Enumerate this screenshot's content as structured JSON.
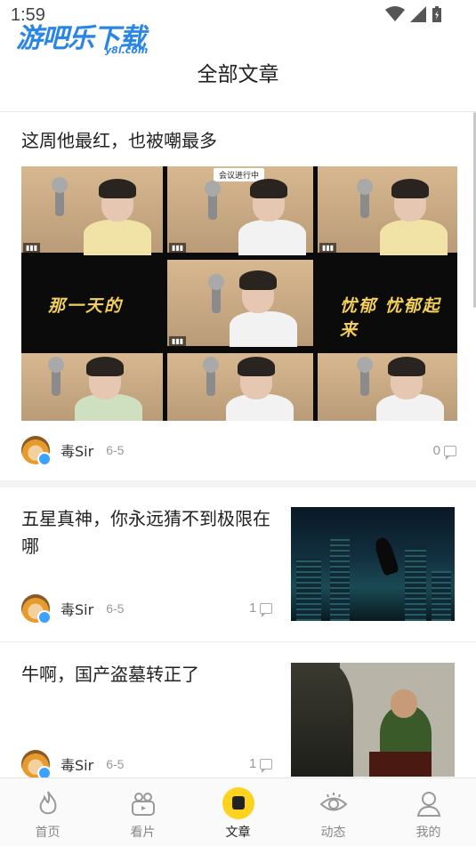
{
  "status_bar": {
    "time": "1:59"
  },
  "watermark": {
    "main": "游吧乐下载",
    "sub": "y8l.com"
  },
  "header": {
    "title": "全部文章"
  },
  "articles": [
    {
      "title": "这周他最红，也被嘲最多",
      "author": "毒Sir",
      "date": "6-5",
      "comments": "0",
      "hero_overlay": {
        "meeting_tag": "会议进行中",
        "lyric_left": "那一天的",
        "lyric_right": "忧郁 忧郁起来"
      }
    },
    {
      "title": "五星真神，你永远猜不到极限在哪",
      "author": "毒Sir",
      "date": "6-5",
      "comments": "1"
    },
    {
      "title": "牛啊，国产盗墓转正了",
      "author": "毒Sir",
      "date": "6-5",
      "comments": "1"
    }
  ],
  "tabs": [
    {
      "label": "首页",
      "icon": "flame-icon"
    },
    {
      "label": "看片",
      "icon": "video-icon"
    },
    {
      "label": "文章",
      "icon": "article-icon",
      "active": true
    },
    {
      "label": "动态",
      "icon": "eye-icon"
    },
    {
      "label": "我的",
      "icon": "user-icon"
    }
  ],
  "colors": {
    "accent": "#ffd21f",
    "watermark_blue": "#2a86e6"
  }
}
